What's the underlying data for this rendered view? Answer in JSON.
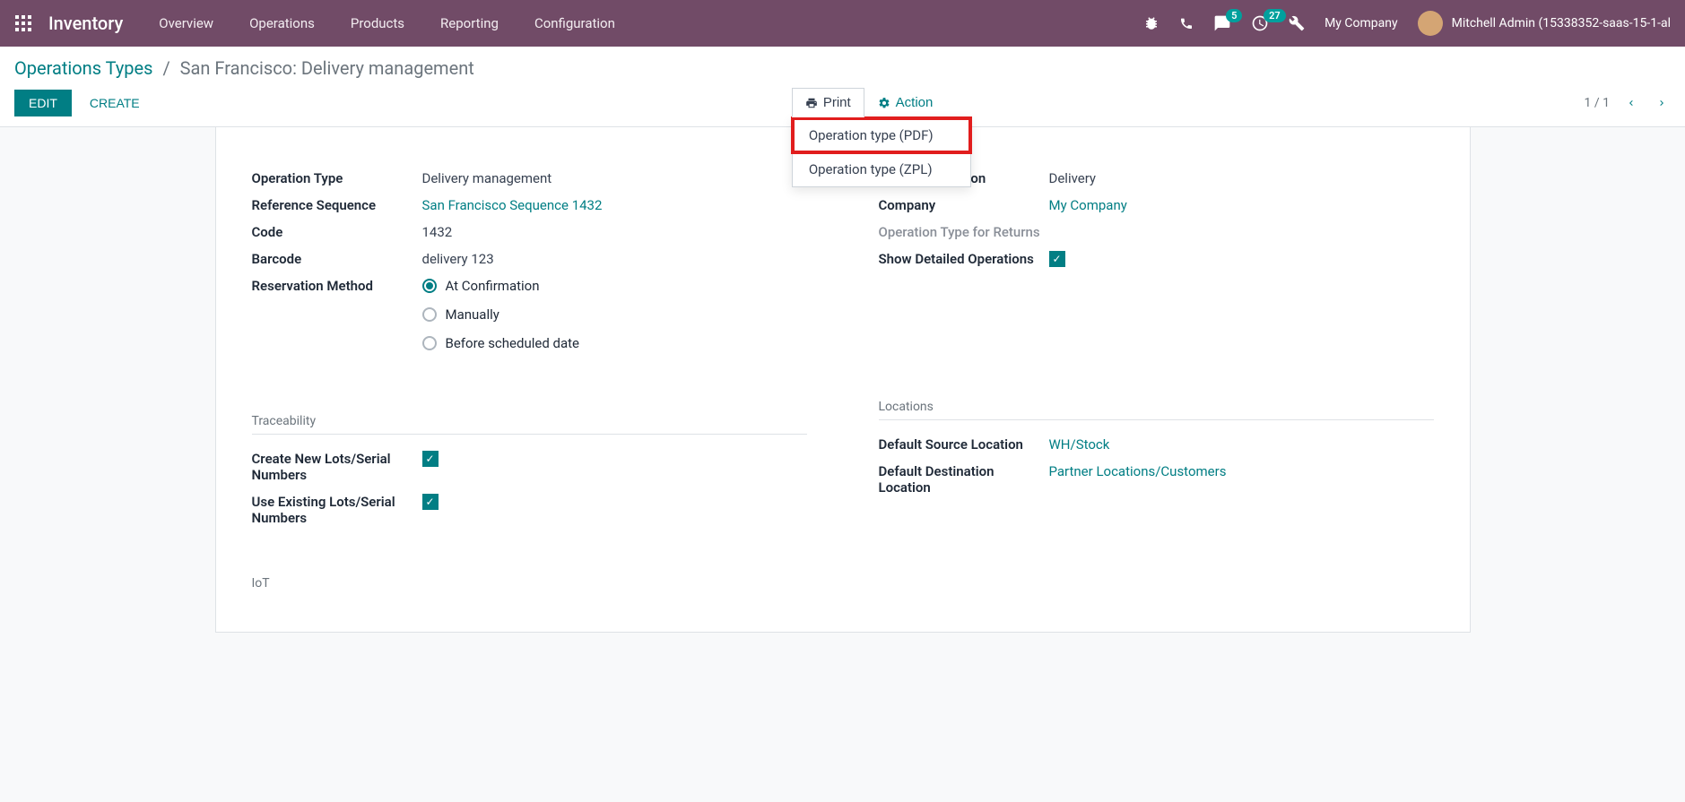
{
  "nav": {
    "brand": "Inventory",
    "menu": [
      "Overview",
      "Operations",
      "Products",
      "Reporting",
      "Configuration"
    ],
    "msg_badge": "5",
    "activity_badge": "27",
    "company": "My Company",
    "user": "Mitchell Admin (15338352-saas-15-1-al"
  },
  "breadcrumb": {
    "parent": "Operations Types",
    "sep": "/",
    "current": "San Francisco: Delivery management"
  },
  "buttons": {
    "edit": "EDIT",
    "create": "CREATE",
    "print": "Print",
    "action": "Action"
  },
  "dropdown": {
    "items": [
      "Operation type (PDF)",
      "Operation type (ZPL)"
    ]
  },
  "pager": {
    "text": "1 / 1"
  },
  "form": {
    "left": {
      "op_type_label": "Operation Type",
      "op_type_value": "Delivery management",
      "ref_seq_label": "Reference Sequence",
      "ref_seq_value": "San Francisco Sequence 1432",
      "code_label": "Code",
      "code_value": "1432",
      "barcode_label": "Barcode",
      "barcode_value": "delivery 123",
      "res_method_label": "Reservation Method",
      "res_options": [
        "At Confirmation",
        "Manually",
        "Before scheduled date"
      ]
    },
    "right": {
      "type_op_label": "Type of Operation",
      "type_op_value": "Delivery",
      "company_label": "Company",
      "company_value": "My Company",
      "op_return_label": "Operation Type for Returns",
      "show_det_label": "Show Detailed Operations"
    },
    "trace": {
      "title": "Traceability",
      "create_lots_label": "Create New Lots/Serial Numbers",
      "use_lots_label": "Use Existing Lots/Serial Numbers"
    },
    "locations": {
      "title": "Locations",
      "src_label": "Default Source Location",
      "src_value": "WH/Stock",
      "dst_label": "Default Destination Location",
      "dst_value": "Partner Locations/Customers"
    },
    "iot": {
      "title": "IoT"
    }
  }
}
